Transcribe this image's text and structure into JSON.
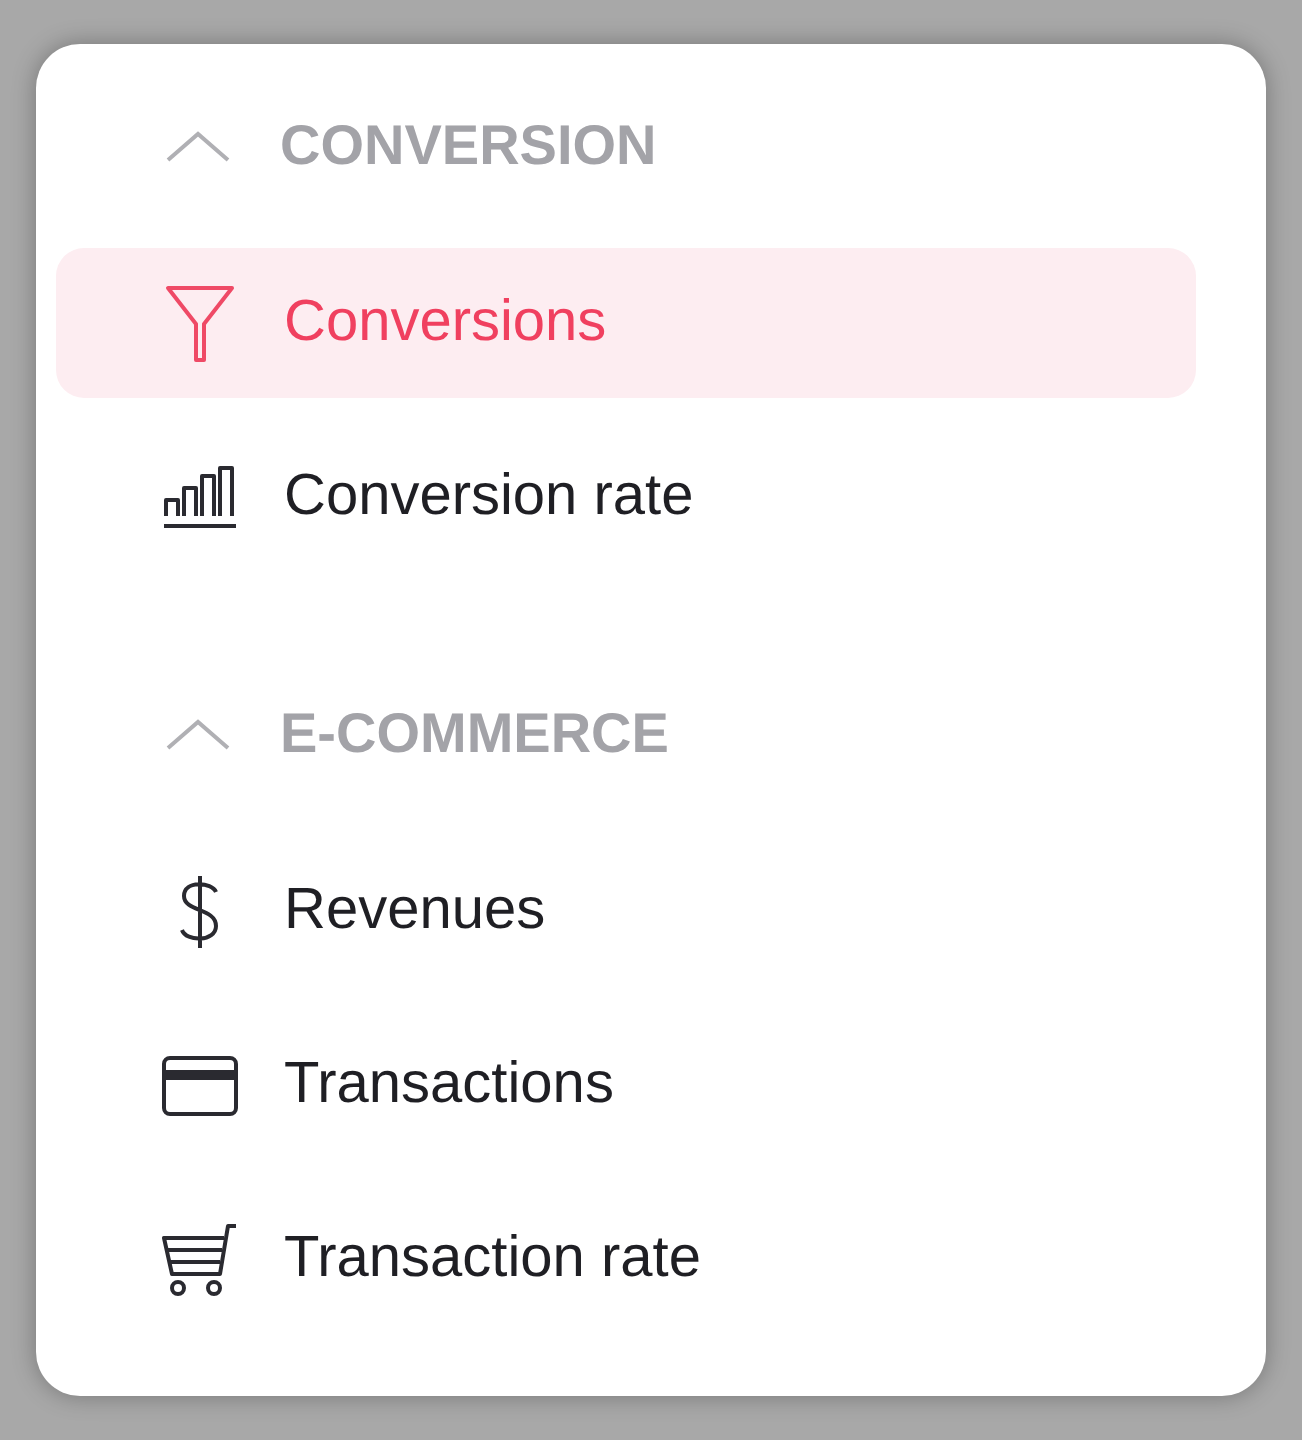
{
  "sections": [
    {
      "title": "CONVERSION",
      "expanded": true,
      "items": [
        {
          "label": "Conversions",
          "kind": "funnel",
          "selected": true
        },
        {
          "label": "Conversion rate",
          "kind": "bars",
          "selected": false
        }
      ]
    },
    {
      "title": "E-COMMERCE",
      "expanded": true,
      "items": [
        {
          "label": "Revenues",
          "kind": "dollar",
          "selected": false
        },
        {
          "label": "Transactions",
          "kind": "card",
          "selected": false
        },
        {
          "label": "Transaction rate",
          "kind": "cart",
          "selected": false
        }
      ]
    }
  ]
}
